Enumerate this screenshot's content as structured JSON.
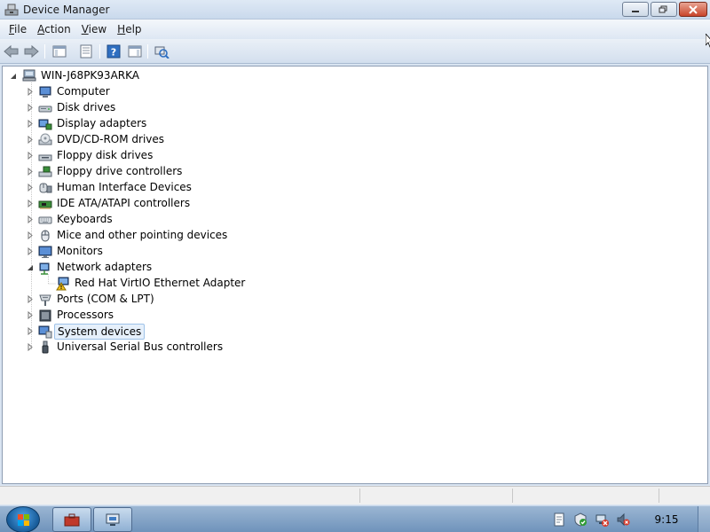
{
  "window": {
    "title": "Device Manager",
    "app_icon": "device-manager-icon",
    "controls": [
      "minimize-icon",
      "maximize-icon",
      "close-icon"
    ]
  },
  "menu": [
    {
      "first": "F",
      "rest": "ile"
    },
    {
      "first": "A",
      "rest": "ction"
    },
    {
      "first": "V",
      "rest": "iew"
    },
    {
      "first": "H",
      "rest": "elp"
    }
  ],
  "toolbar": {
    "buttons": [
      "back-icon",
      "forward-icon",
      "show-hide-console-tree-icon",
      "properties-icon",
      "help-icon",
      "action-pane-icon",
      "scan-hardware-icon"
    ]
  },
  "tree": {
    "root": {
      "label": "WIN-J68PK93ARKA",
      "icon": "computer-root-icon"
    },
    "categories": [
      {
        "label": "Computer",
        "icon": "computer-icon"
      },
      {
        "label": "Disk drives",
        "icon": "disk-drive-icon"
      },
      {
        "label": "Display adapters",
        "icon": "display-adapter-icon"
      },
      {
        "label": "DVD/CD-ROM drives",
        "icon": "dvd-drive-icon"
      },
      {
        "label": "Floppy disk drives",
        "icon": "floppy-drive-icon"
      },
      {
        "label": "Floppy drive controllers",
        "icon": "floppy-controller-icon"
      },
      {
        "label": "Human Interface Devices",
        "icon": "hid-icon"
      },
      {
        "label": "IDE ATA/ATAPI controllers",
        "icon": "ide-controller-icon"
      },
      {
        "label": "Keyboards",
        "icon": "keyboard-icon"
      },
      {
        "label": "Mice and other pointing devices",
        "icon": "mouse-icon"
      },
      {
        "label": "Monitors",
        "icon": "monitor-icon"
      },
      {
        "label": "Network adapters",
        "icon": "network-adapter-icon",
        "expanded": true
      },
      {
        "label": "Red Hat VirtIO Ethernet Adapter",
        "icon": "warning-network-adapter-icon",
        "child": true
      },
      {
        "label": "Ports (COM & LPT)",
        "icon": "port-icon"
      },
      {
        "label": "Processors",
        "icon": "processor-icon"
      },
      {
        "label": "System devices",
        "icon": "system-devices-icon",
        "selected": true
      },
      {
        "label": "Universal Serial Bus controllers",
        "icon": "usb-icon"
      }
    ]
  },
  "taskbar": {
    "start": "start-orb-icon",
    "buttons": [
      "toolbox-app-icon",
      "device-manager-task-icon"
    ],
    "tray": [
      "notes-tray-icon",
      "action-center-tray-icon",
      "network-error-tray-icon",
      "volume-muted-tray-icon"
    ],
    "clock": "9:15"
  }
}
